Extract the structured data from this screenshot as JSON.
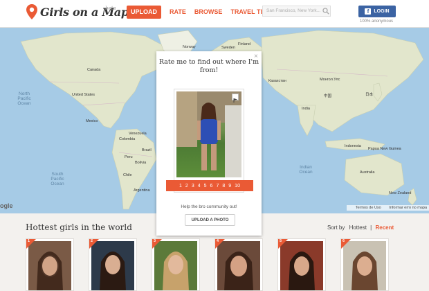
{
  "header": {
    "logo_text": "Girls on a Map",
    "logo_beta": "beta",
    "nav": {
      "upload": "UPLOAD",
      "rate": "RATE",
      "browse": "BROWSE",
      "travel_tips": "TRAVEL TIPS"
    },
    "search_placeholder": "San Francisco, New York...",
    "login_label": "LOGIN",
    "anon_text": "100% anonymous"
  },
  "map": {
    "countries": [
      "Canada",
      "United States",
      "Mexico",
      "Venezuela",
      "Colombia",
      "Peru",
      "Brazil",
      "Bolivia",
      "Chile",
      "Argentina",
      "Sweden",
      "Finland",
      "Norway",
      "Казахстан",
      "Монгол Улс",
      "中国",
      "日本",
      "India",
      "Indonesia",
      "Papua New Guinea",
      "Australia",
      "New Zealand"
    ],
    "oceans": [
      "North Pacific Ocean",
      "South Pacific Ocean",
      "Indian Ocean"
    ],
    "footer_terms": "Termos de Uso",
    "footer_report": "Informar erro no mapa",
    "google": "ogle"
  },
  "popup": {
    "title": "Rate me to find out where I'm from!",
    "ratings": [
      "1",
      "2",
      "3",
      "4",
      "5",
      "6",
      "7",
      "8",
      "9",
      "10"
    ],
    "help_text": "Help the bro community out!",
    "upload_button": "UPLOAD A PHOTO",
    "close_symbol": "×"
  },
  "gallery": {
    "title": "Hottest girls in the world",
    "sort_by": "Sort by",
    "sort_hottest": "Hottest",
    "sort_separator": "|",
    "sort_recent": "Recent",
    "items": [
      {
        "rank": "1"
      },
      {
        "rank": "2"
      },
      {
        "rank": "3"
      },
      {
        "rank": "4"
      },
      {
        "rank": "5"
      },
      {
        "rank": "6"
      }
    ]
  },
  "colors": {
    "accent": "#ea5a35",
    "facebook": "#3b63a3",
    "water": "#a6cbe6",
    "land": "#e2e6cc"
  }
}
